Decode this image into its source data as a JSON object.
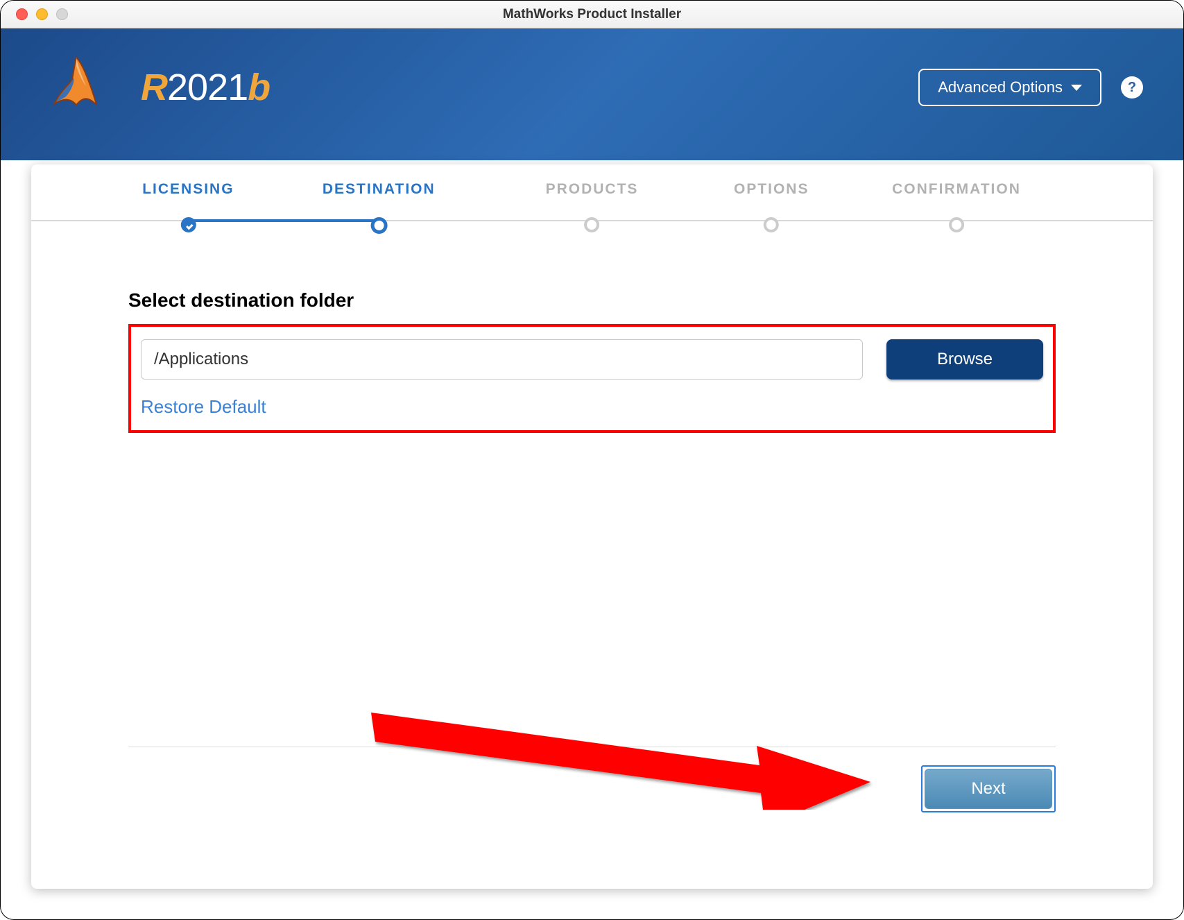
{
  "window": {
    "title": "MathWorks Product Installer"
  },
  "header": {
    "version_prefix": "R",
    "version_year": "2021",
    "version_suffix": "b",
    "adv_options": "Advanced Options",
    "help_symbol": "?"
  },
  "stepper": {
    "licensing": "LICENSING",
    "destination": "DESTINATION",
    "products": "PRODUCTS",
    "options": "OPTIONS",
    "confirmation": "CONFIRMATION"
  },
  "content": {
    "section_title": "Select destination folder",
    "path_value": "/Applications",
    "browse": "Browse",
    "restore": "Restore Default"
  },
  "footer": {
    "next": "Next"
  }
}
